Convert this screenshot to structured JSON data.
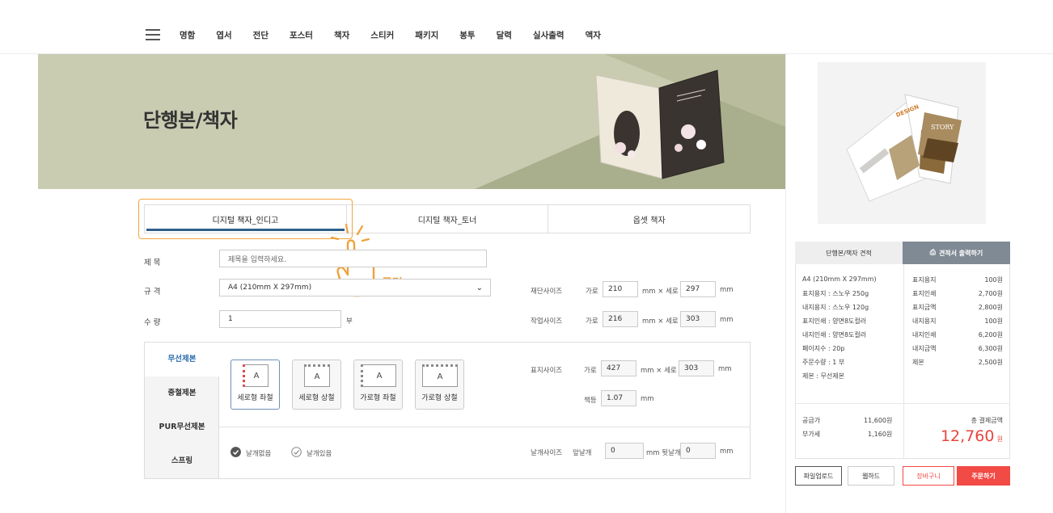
{
  "nav": {
    "items": [
      "명함",
      "엽서",
      "전단",
      "포스터",
      "책자",
      "스티커",
      "패키지",
      "봉투",
      "달력",
      "실사출력",
      "액자"
    ]
  },
  "hero": {
    "title": "단행본/책자"
  },
  "tabs": [
    "디지털 책자_인디고",
    "디지털 책자_토너",
    "옵셋 책자"
  ],
  "annotation": {
    "click_label": "클릭"
  },
  "form": {
    "title_label": "제 목",
    "title_placeholder": "제목을 입력하세요.",
    "spec_label": "규 격",
    "spec_value": "A4 (210mm X 297mm)",
    "qty_label": "수 량",
    "qty_value": "1",
    "qty_unit": "부",
    "cut_size": {
      "label": "재단사이즈",
      "w_label": "가로",
      "w": "210",
      "h_label": "세로",
      "h": "297",
      "unit": "mm"
    },
    "work_size": {
      "label": "작업사이즈",
      "w_label": "가로",
      "w": "216",
      "h_label": "세로",
      "h": "303",
      "unit": "mm"
    },
    "cover_size": {
      "label": "표지사이즈",
      "w_label": "가로",
      "w": "427",
      "h_label": "세로",
      "h": "303",
      "unit": "mm"
    },
    "spine": {
      "label": "책등",
      "value": "1.07",
      "unit": "mm"
    },
    "wing_size": {
      "label": "날개사이즈",
      "front_label": "앞날개",
      "front": "0",
      "back_label": "뒷날개",
      "back": "0",
      "unit": "mm"
    }
  },
  "binding": {
    "options": [
      "무선제본",
      "중철제본",
      "PUR무선제본",
      "스프링"
    ],
    "types": [
      {
        "label": "세로형 좌철",
        "letter": "A"
      },
      {
        "label": "세로형 상철",
        "letter": "A"
      },
      {
        "label": "가로형 좌철",
        "letter": "A"
      },
      {
        "label": "가로형 상철",
        "letter": "A"
      }
    ],
    "wing": [
      "날개없음",
      "날개있음"
    ]
  },
  "estimate": {
    "tab1": "단행본/책자 견적",
    "tab2": "견적서 출력하기",
    "specs": [
      "A4 (210mm X 297mm)",
      "표지용지 : 스노우 250g",
      "내지용지 : 스노우 120g",
      "표지인쇄 : 양면8도컬러",
      "내지인쇄 : 양면8도컬러",
      "페이지수 : 20p",
      "주문수량 : 1 부",
      "제본 : 무선제본"
    ],
    "prices": [
      {
        "name": "표지용지",
        "value": "100원"
      },
      {
        "name": "표지인쇄",
        "value": "2,700원"
      },
      {
        "name": "표지금액",
        "value": "2,800원"
      },
      {
        "name": "내지용지",
        "value": "100원"
      },
      {
        "name": "내지인쇄",
        "value": "6,200원"
      },
      {
        "name": "내지금액",
        "value": "6,300원"
      },
      {
        "name": "제본",
        "value": "2,500원"
      }
    ],
    "supply_label": "공급가",
    "supply_value": "11,600원",
    "vat_label": "부가세",
    "vat_value": "1,160원",
    "total_label": "총 결제금액",
    "total_value": "12,760",
    "total_unit": "원"
  },
  "preview": {
    "story_text": "STORY",
    "design_text": "DESIGN"
  },
  "buttons": {
    "upload": "파일업로드",
    "webhard": "웹하드",
    "cart": "장바구니",
    "order": "주문하기"
  },
  "colors": {
    "accent_blue": "#2f5f8a",
    "highlight": "#f3a53b",
    "total_red": "#e8453c",
    "order_red": "#f24a45"
  }
}
